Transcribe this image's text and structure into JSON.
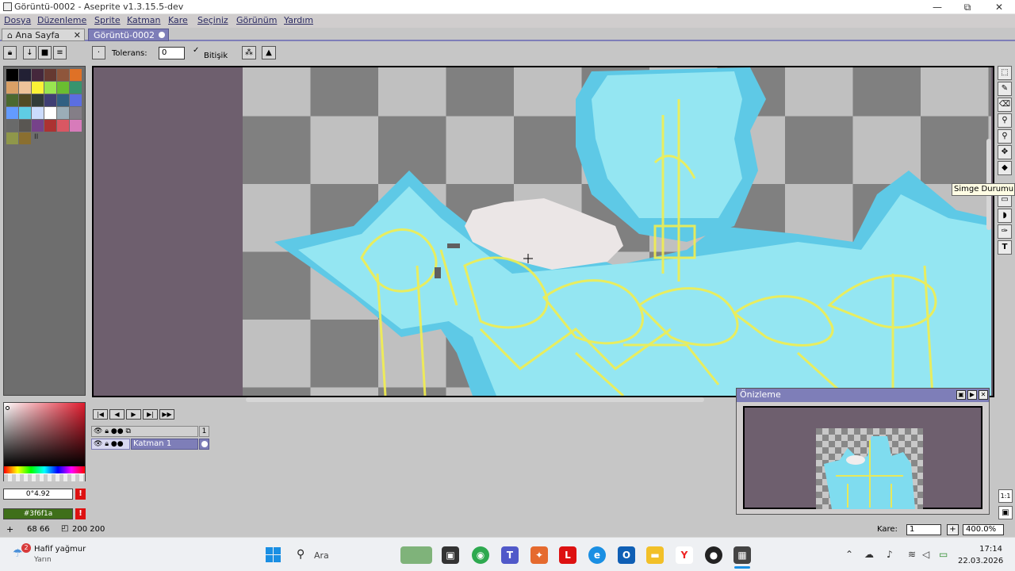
{
  "window": {
    "title": "Görüntü-0002 - Aseprite v1.3.15.5-dev",
    "minimize_glyph": "—",
    "maximize_glyph": "⧉",
    "close_glyph": "✕"
  },
  "menu": [
    "Dosya",
    "Düzenleme",
    "Sprite",
    "Katman",
    "Kare",
    "Seçiniz",
    "Görünüm",
    "Yardım"
  ],
  "tabs": {
    "home_label": "Ana Sayfa",
    "home_icon": "home-icon",
    "home_close": "✕",
    "file_label": "Görüntü-0002"
  },
  "toolbar": {
    "tolerance_label": "Tolerans:",
    "tolerance_value": "0",
    "contiguous_label": "Bitişik",
    "contiguous_checked": true
  },
  "palette": {
    "colors": [
      "#000000",
      "#222034",
      "#45283c",
      "#663931",
      "#8f563b",
      "#df7126",
      "#d9a066",
      "#eec39a",
      "#fbf236",
      "#99e550",
      "#6abe30",
      "#37946e",
      "#4b692f",
      "#524b24",
      "#323c39",
      "#3f3f74",
      "#306082",
      "#5b6ee1",
      "#639bff",
      "#5fcde4",
      "#cbdbfc",
      "#ffffff",
      "#9badb7",
      "#847e87",
      "#696a6a",
      "#595652",
      "#76428a",
      "#ac3232",
      "#d95763",
      "#d77bba",
      "#8f974a",
      "#8a6f30"
    ],
    "marker": "II"
  },
  "tooltip": "Simge Durumuna",
  "color_bar": {
    "background_value": "0°4.92",
    "foreground_value": "#3f6f1a",
    "warn_glyph": "!",
    "fg_color": "#3f6f1a"
  },
  "timeline": {
    "frame_number": "1",
    "layer_name": "Katman 1"
  },
  "preview": {
    "title": "Önizleme"
  },
  "status": {
    "cursor": "68 66",
    "size": "200 200",
    "frame_label": "Kare:",
    "frame_value": "1",
    "zoom": "400.0%",
    "plus_glyph": "+",
    "frame_plus_glyph": "+"
  },
  "right_tools": {
    "ratio_label": "1:1"
  },
  "taskbar": {
    "weather_title": "Hafif yağmur",
    "weather_sub": "Yarın",
    "weather_badge": "2",
    "search_label": "Ara",
    "time": "17:14",
    "date": "22.03.2026"
  }
}
